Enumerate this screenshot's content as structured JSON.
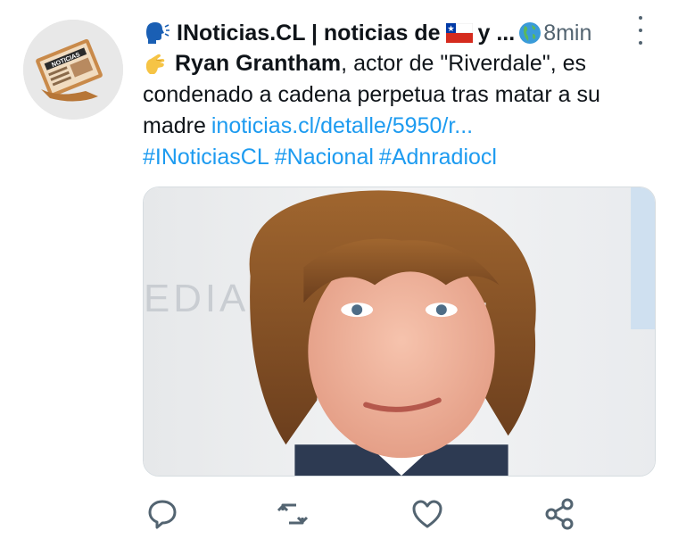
{
  "tweet": {
    "account_name": "INoticias.CL | noticias de",
    "name_trailing": "y ...",
    "time": "8min",
    "text_lead": "Ryan Grantham",
    "text_line1_rest": ", actor de \"Riverdale\", es",
    "text_line2": "condenado a cadena perpetua tras matar a su",
    "text_line3_prefix": "madre",
    "link": "inoticias.cl/detalle/5950/r...",
    "hashtags": [
      "#INoticiasCL",
      "#Nacional",
      "#Adnradiocl"
    ],
    "avatar_logo_text": "NOTICIAS",
    "media_backdrop_text": "EDIA"
  },
  "icons": {
    "header_lead": "speaking-head-icon",
    "flag": "chile-flag-icon",
    "globe": "globe-americas-icon",
    "text_lead": "pinching-hand-icon",
    "more": "more-vertical-icon",
    "reply": "reply-icon",
    "retweet": "retweet-icon",
    "like": "heart-icon",
    "share": "share-icon"
  },
  "colors": {
    "link": "#1d9bf0",
    "text": "#0f1419",
    "secondary": "#536471",
    "action_icon": "#536471"
  }
}
